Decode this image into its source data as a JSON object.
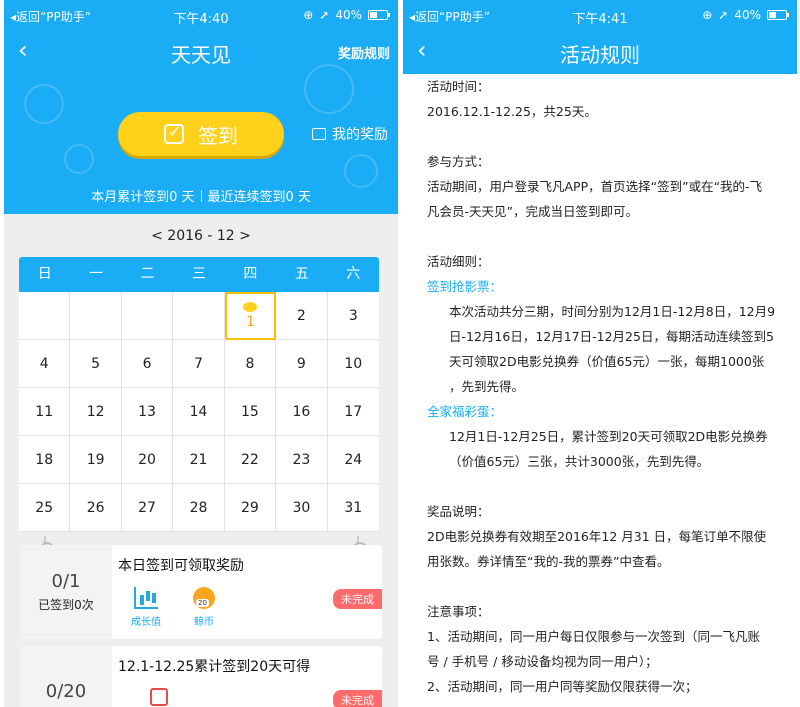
{
  "status_bar": {
    "back_label": "◂返回“PP助手”",
    "left_time": "下午4:40",
    "right_time": "下午4:41",
    "battery": "40%"
  },
  "left": {
    "title": "天天见",
    "rules_link": "奖励规则",
    "signin_label": "签到",
    "my_reward": "我的奖励",
    "stats_month": "本月累计签到0 天",
    "stats_streak": "最近连续签到0 天",
    "month_nav": "< 2016 - 12 >",
    "weekdays": [
      "日",
      "一",
      "二",
      "三",
      "四",
      "五",
      "六"
    ],
    "days": [
      "",
      "",
      "",
      "",
      "1",
      "2",
      "3",
      "4",
      "5",
      "6",
      "7",
      "8",
      "9",
      "10",
      "11",
      "12",
      "13",
      "14",
      "15",
      "16",
      "17",
      "18",
      "19",
      "20",
      "21",
      "22",
      "23",
      "24",
      "25",
      "26",
      "27",
      "28",
      "29",
      "30",
      "31"
    ],
    "cards": [
      {
        "progress": "0/1",
        "sub": "已签到0次",
        "title": "本日签到可领取奖励",
        "rewards": [
          "成长值",
          "鲸币"
        ],
        "status": "未完成"
      },
      {
        "progress": "0/20",
        "title": "12.1-12.25累计签到20天可得",
        "status": "未完成"
      }
    ]
  },
  "right": {
    "title": "活动规则",
    "lines": [
      {
        "text": "活动时间：",
        "style": "label"
      },
      {
        "text": "2016.12.1-12.25，共25天。",
        "style": "plain"
      },
      {
        "text": "",
        "style": "gap"
      },
      {
        "text": "参与方式：",
        "style": "label"
      },
      {
        "text": "活动期间，用户登录飞凡APP，首页选择“签到”或在“我的-飞",
        "style": "plain"
      },
      {
        "text": "凡会员-天天见”，完成当日签到即可。",
        "style": "plain"
      },
      {
        "text": "",
        "style": "gap"
      },
      {
        "text": "活动细则：",
        "style": "label"
      },
      {
        "text": "签到抢影票：",
        "style": "hl"
      },
      {
        "text": "本次活动共分三期，时间分别为12月1日-12月8日，12月9",
        "style": "indent"
      },
      {
        "text": "日-12月16日，12月17日-12月25日，每期活动连续签到5",
        "style": "indent"
      },
      {
        "text": "天可领取2D电影兑换券（价值65元）一张，每期1000张",
        "style": "indent"
      },
      {
        "text": "，先到先得。",
        "style": "indent"
      },
      {
        "text": "全家福彩蛋：",
        "style": "hl"
      },
      {
        "text": "12月1日-12月25日，累计签到20天可领取2D电影兑换券",
        "style": "indent"
      },
      {
        "text": "（价值65元）三张，共计3000张，先到先得。",
        "style": "indent"
      },
      {
        "text": "",
        "style": "gap"
      },
      {
        "text": "奖品说明：",
        "style": "label"
      },
      {
        "text": "2D电影兑换券有效期至2016年12 月31 日，每笔订单不限使",
        "style": "plain"
      },
      {
        "text": "用张数。券详情至“我的-我的票券”中查看。",
        "style": "plain"
      },
      {
        "text": "",
        "style": "gap"
      },
      {
        "text": "注意事项：",
        "style": "label"
      },
      {
        "text": "1、活动期间，同一用户每日仅限参与一次签到（同一飞凡账",
        "style": "plain"
      },
      {
        "text": "号 / 手机号 / 移动设备均视为同一用户）；",
        "style": "plain"
      },
      {
        "text": "2、活动期间，同一用户同等奖励仅限获得一次；",
        "style": "plain"
      }
    ]
  },
  "colors": {
    "primary": "#1aacf4",
    "button": "#ffd11a",
    "pending": "#ff6b6b",
    "today_border": "#ffc107"
  }
}
